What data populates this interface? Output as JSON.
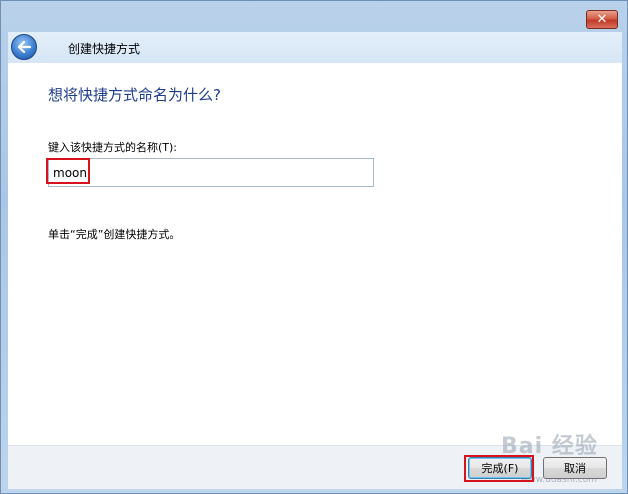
{
  "window": {
    "close_label": "✕"
  },
  "header": {
    "title": "创建快捷方式"
  },
  "content": {
    "question": "想将快捷方式命名为什么?",
    "field_label": "键入该快捷方式的名称(T):",
    "name_value": "moon",
    "hint": "单击“完成”创建快捷方式。"
  },
  "footer": {
    "finish_label": "完成(F)",
    "cancel_label": "取消"
  },
  "watermark": {
    "brand": "Bai 经验",
    "url": "www.udashi.com"
  },
  "colors": {
    "question_text": "#1e3d8f",
    "highlight": "#d6121b"
  }
}
